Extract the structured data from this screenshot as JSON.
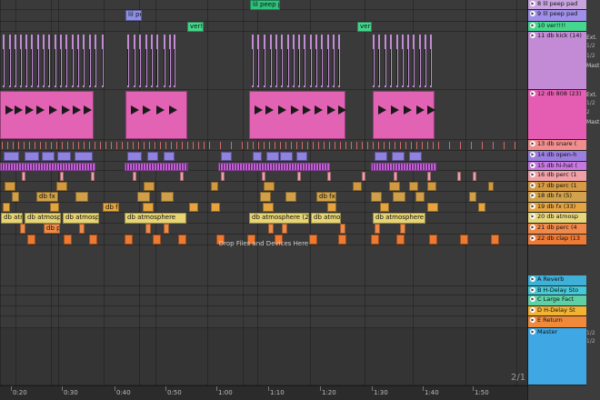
{
  "tracks": [
    {
      "key": "t8",
      "label": "8 lil peep pad",
      "color": "#c8a4df"
    },
    {
      "key": "t9",
      "label": "9 lil peep pad",
      "color": "#9f8fe8"
    },
    {
      "key": "t10",
      "label": "10 ver!!!!",
      "color": "#46d68e"
    },
    {
      "key": "t11",
      "label": "11 db kick (14)",
      "color": "#c38bd6"
    },
    {
      "key": "t12",
      "label": "12 db 808 (23)",
      "color": "#e55db2"
    },
    {
      "key": "t13",
      "label": "13 db snare (",
      "color": "#f08e8e"
    },
    {
      "key": "t14",
      "label": "14 db open-h",
      "color": "#9a7fe0"
    },
    {
      "key": "t15",
      "label": "15 db hi-hat (",
      "color": "#c877e0"
    },
    {
      "key": "t16",
      "label": "16 db perc (1",
      "color": "#f2a0a8"
    },
    {
      "key": "t17",
      "label": "17 db perc (1",
      "color": "#d59a43"
    },
    {
      "key": "t18",
      "label": "18 db fx (5)",
      "color": "#d1a24b"
    },
    {
      "key": "t19",
      "label": "19 db fx (33)",
      "color": "#e6a43e"
    },
    {
      "key": "t20",
      "label": "20 db atmosp",
      "color": "#e8d77a"
    },
    {
      "key": "t21",
      "label": "21 db perc (4",
      "color": "#f08a4b"
    },
    {
      "key": "t22",
      "label": "22 db clap (13",
      "color": "#ef7a34"
    },
    {
      "key": "ra",
      "label": "A Reverb",
      "color": "#3fb0d8"
    },
    {
      "key": "rb",
      "label": "B H-Delay Sto",
      "color": "#43c9d8"
    },
    {
      "key": "rc",
      "label": "C Large Fact",
      "color": "#5ed0a6"
    },
    {
      "key": "rd",
      "label": "D H-Delay St",
      "color": "#f2b233"
    },
    {
      "key": "re",
      "label": "E Return",
      "color": "#f08a3a"
    },
    {
      "key": "master",
      "label": "Master",
      "color": "#3fa8e4"
    }
  ],
  "clips": {
    "pad_peep": "lil peep pad",
    "pad_peep_short": "lil pee",
    "ver": "ver!!!",
    "db_fx": "db fx",
    "db_atm": "db atm",
    "db_atmosphere": "db atmosphere",
    "db_atmosphere_2": "db atmosphere (2)",
    "db_atmosph": "db atmosph",
    "db_atmospher": "db atmospher",
    "db_atmosp": "db atmosp",
    "db_open_h": "db open-h",
    "db_pe": "db pe"
  },
  "side_labels": {
    "ext": "Ext.",
    "half": "1/2",
    "master": "Mast",
    "two": "2"
  },
  "drop_hint": "Drop Files and Devices Here",
  "pager": "2/1",
  "ruler": [
    "0:20",
    "0:30",
    "0:40",
    "0:50",
    "1:00",
    "1:10",
    "1:20",
    "1:30",
    "1:40",
    "1:50"
  ]
}
